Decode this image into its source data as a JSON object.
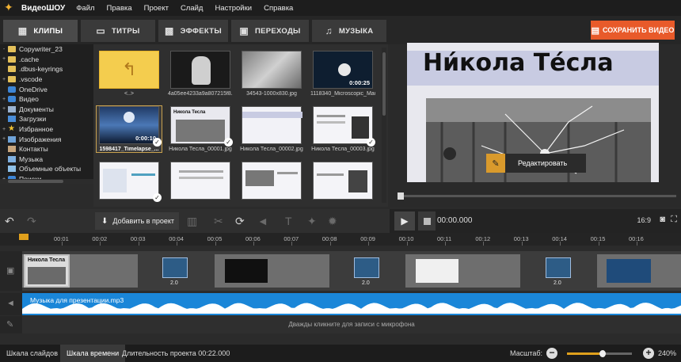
{
  "app": {
    "name": "ВидеоШОУ"
  },
  "menu": [
    "Файл",
    "Правка",
    "Проект",
    "Слайд",
    "Настройки",
    "Справка"
  ],
  "tabs": [
    {
      "label": "КЛИПЫ",
      "icon": "film-icon"
    },
    {
      "label": "ТИТРЫ",
      "icon": "titles-icon"
    },
    {
      "label": "ЭФФЕКТЫ",
      "icon": "effects-icon"
    },
    {
      "label": "ПЕРЕХОДЫ",
      "icon": "transitions-icon"
    },
    {
      "label": "МУЗЫКА",
      "icon": "music-icon"
    }
  ],
  "save_button": "СОХРАНИТЬ ВИДЕО",
  "tree": [
    {
      "label": "Copywriter_23",
      "expander": "-",
      "icon": "user-folder"
    },
    {
      "label": ".cache",
      "expander": "+",
      "icon": "folder"
    },
    {
      "label": ".dbus-keyrings",
      "expander": "",
      "icon": "folder"
    },
    {
      "label": ".vscode",
      "expander": "+",
      "icon": "folder"
    },
    {
      "label": "OneDrive",
      "expander": "",
      "icon": "cloud"
    },
    {
      "label": "Видео",
      "expander": "+",
      "icon": "video"
    },
    {
      "label": "Документы",
      "expander": "+",
      "icon": "documents"
    },
    {
      "label": "Загрузки",
      "expander": "",
      "icon": "downloads"
    },
    {
      "label": "Избранное",
      "expander": "+",
      "icon": "star"
    },
    {
      "label": "Изображения",
      "expander": "+",
      "icon": "images"
    },
    {
      "label": "Контакты",
      "expander": "",
      "icon": "contacts"
    },
    {
      "label": "Музыка",
      "expander": "",
      "icon": "music"
    },
    {
      "label": "Объемные объекты",
      "expander": "",
      "icon": "3d-objects"
    },
    {
      "label": "Поиски",
      "expander": "+",
      "icon": "search"
    }
  ],
  "grid": [
    {
      "caption": "<..>",
      "kind": "up",
      "duration": "",
      "selected": false,
      "checked": false
    },
    {
      "caption": "4a05ee4233a9a807215f8...",
      "kind": "portrait",
      "duration": "",
      "selected": false,
      "checked": false
    },
    {
      "caption": "34543-1000x830.jpg",
      "kind": "lab",
      "duration": "",
      "selected": false,
      "checked": false
    },
    {
      "caption": "1118340_Microscopic_Mac...",
      "kind": "video",
      "duration": "0:00:25",
      "selected": false,
      "checked": false
    },
    {
      "caption": "1598417_Timelapse_...",
      "kind": "sky",
      "duration": "0:00:10",
      "selected": true,
      "checked": true
    },
    {
      "caption": "Никола Тесла_00001.jpg",
      "kind": "slide",
      "duration": "",
      "selected": false,
      "checked": true
    },
    {
      "caption": "Никола Тесла_00002.jpg",
      "kind": "slide-blank",
      "duration": "",
      "selected": false,
      "checked": false
    },
    {
      "caption": "Никола Тесла_00003.jpg",
      "kind": "slide-text",
      "duration": "",
      "selected": false,
      "checked": true
    },
    {
      "caption": "",
      "kind": "slide-graph",
      "duration": "",
      "selected": false,
      "checked": true
    },
    {
      "caption": "",
      "kind": "slide-text2",
      "duration": "",
      "selected": false,
      "checked": false
    },
    {
      "caption": "",
      "kind": "slide-text3",
      "duration": "",
      "selected": false,
      "checked": false
    },
    {
      "caption": "",
      "kind": "slide-photo",
      "duration": "",
      "selected": false,
      "checked": false
    }
  ],
  "preview": {
    "title": "Ни́кола Те́сла",
    "edit_label": "Редактировать"
  },
  "toolbar": {
    "add_label": "Добавить в проект"
  },
  "player": {
    "time": "00:00.000",
    "ratio": "16:9"
  },
  "ruler": [
    "00:01",
    "00:02",
    "00:03",
    "00:04",
    "00:05",
    "00:06",
    "00:07",
    "00:08",
    "00:09",
    "00:10",
    "00:11",
    "00:12",
    "00:13",
    "00:14",
    "00:15",
    "00:16"
  ],
  "timeline": {
    "clip1_title": "Никола Тесла",
    "transition_durations": [
      "2.0",
      "2.0",
      "2.0",
      "2.0"
    ],
    "audio_title": "Музыка для презентации.mp3",
    "mic_hint": "Дважды кликните для записи с микрофона"
  },
  "status": {
    "tab_slides": "Шкала слайдов",
    "tab_timeline": "Шкала времени",
    "duration": "Длительность проекта 00:22.000",
    "zoom_label": "Масштаб:",
    "zoom_value": "240%",
    "zoom_fraction": 0.55
  },
  "colors": {
    "accent": "#e0a01c",
    "save": "#e85a2a",
    "audio": "#1a86d8"
  }
}
